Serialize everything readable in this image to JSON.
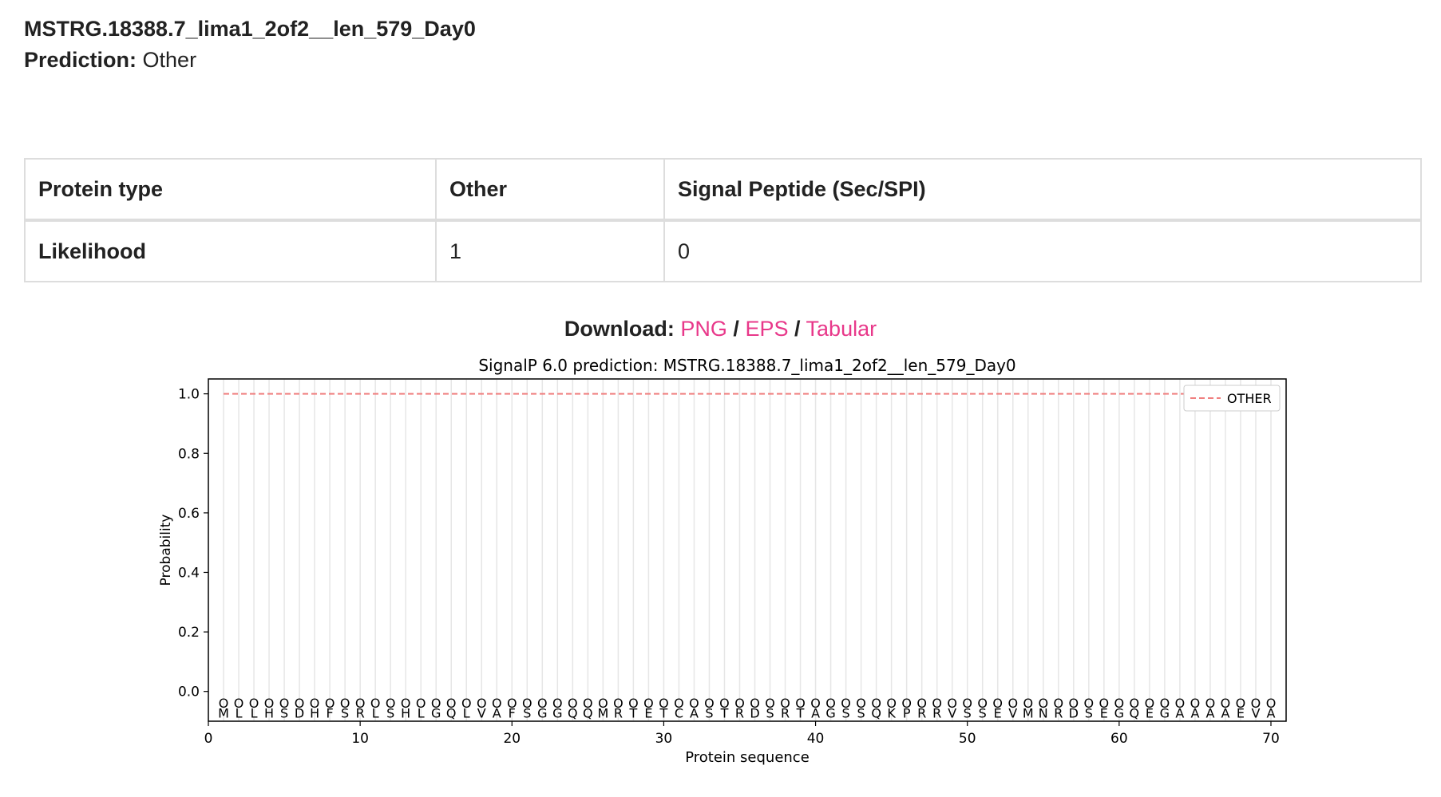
{
  "header": {
    "sequence_name": "MSTRG.18388.7_lima1_2of2__len_579_Day0",
    "prediction_label": "Prediction:",
    "prediction_value": "Other"
  },
  "table": {
    "rows": [
      [
        "Protein type",
        "Other",
        "Signal Peptide (Sec/SPI)"
      ],
      [
        "Likelihood",
        "1",
        "0"
      ]
    ]
  },
  "download": {
    "label": "Download:",
    "separator": "/",
    "links": [
      "PNG",
      "EPS",
      "Tabular"
    ],
    "link_color": "#e8388a"
  },
  "chart_data": {
    "type": "line",
    "title": "SignalP 6.0 prediction: MSTRG.18388.7_lima1_2of2__len_579_Day0",
    "xlabel": "Protein sequence",
    "ylabel": "Probability",
    "xlim": [
      0,
      71
    ],
    "ylim": [
      -0.1,
      1.05
    ],
    "xticks": [
      0,
      10,
      20,
      30,
      40,
      50,
      60,
      70
    ],
    "yticks": [
      0.0,
      0.2,
      0.4,
      0.6,
      0.8,
      1.0
    ],
    "ytick_labels": [
      "0.0",
      "0.2",
      "0.4",
      "0.6",
      "0.8",
      "1.0"
    ],
    "sequence": "MLLHSDHFSRLSHLGQLVAFSGGQQMRTETCASTRDSRTAGSSQKPRRVSSEVMNRDSEGQEGAAAAEVA",
    "sequence_start": 1,
    "marker_symbol": "O",
    "series": [
      {
        "name": "OTHER",
        "style": "dashed",
        "color": "#f08080",
        "x_start": 1,
        "x_end": 70,
        "y": 1.0
      }
    ],
    "legend_position": "top-right",
    "vertical_gridlines": true
  }
}
